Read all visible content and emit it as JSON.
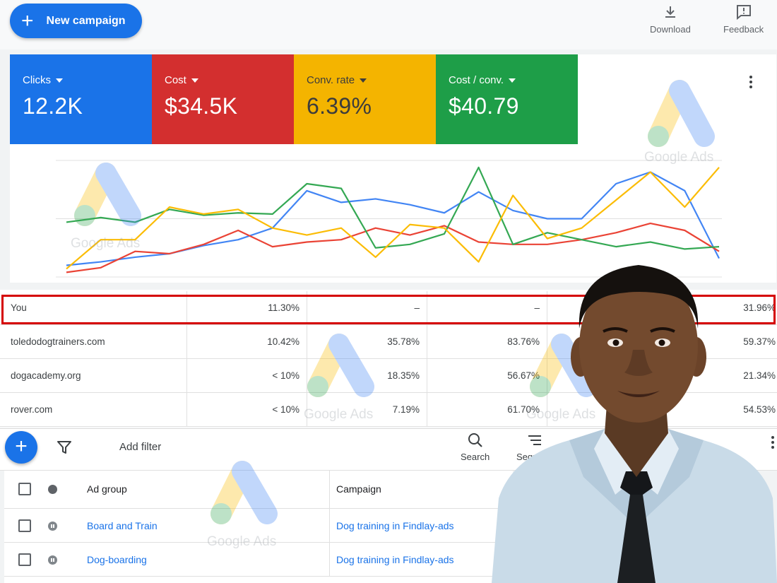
{
  "toolbar_top": {
    "new_campaign_label": "New campaign",
    "download_label": "Download",
    "feedback_label": "Feedback"
  },
  "scorecards": [
    {
      "label": "Clicks",
      "value": "12.2K",
      "color": "#1a73e8"
    },
    {
      "label": "Cost",
      "value": "$34.5K",
      "color": "#d32f2f"
    },
    {
      "label": "Conv. rate",
      "value": "6.39%",
      "color": "#f4b400"
    },
    {
      "label": "Cost / conv.",
      "value": "$40.79",
      "color": "#1e9e48"
    }
  ],
  "watermark_text": "Google Ads",
  "chart_data": {
    "type": "line",
    "x": [
      0,
      1,
      2,
      3,
      4,
      5,
      6,
      7,
      8,
      9,
      10,
      11,
      12,
      13,
      14,
      15,
      16,
      17,
      18,
      19
    ],
    "ylim": [
      0,
      100
    ],
    "grid": true,
    "series": [
      {
        "color": "#4285f4",
        "values": [
          10,
          13,
          17,
          20,
          27,
          32,
          42,
          74,
          64,
          67,
          62,
          55,
          73,
          57,
          50,
          50,
          80,
          90,
          74,
          16
        ]
      },
      {
        "color": "#ea4335",
        "values": [
          4,
          8,
          22,
          20,
          28,
          40,
          26,
          30,
          32,
          42,
          36,
          44,
          30,
          28,
          28,
          32,
          38,
          46,
          40,
          22
        ]
      },
      {
        "color": "#34a853",
        "values": [
          47,
          51,
          47,
          58,
          53,
          55,
          54,
          80,
          76,
          25,
          28,
          37,
          94,
          28,
          38,
          32,
          26,
          30,
          24,
          26
        ]
      },
      {
        "color": "#fbbc04",
        "values": [
          7,
          32,
          32,
          60,
          54,
          58,
          42,
          36,
          42,
          17,
          45,
          42,
          13,
          70,
          33,
          42,
          66,
          90,
          60,
          94
        ]
      }
    ]
  },
  "competitor_rows": [
    {
      "domain": "You",
      "c1": "11.30%",
      "c2": "–",
      "c3": "–",
      "c4": "31.96%"
    },
    {
      "domain": "toledodogtrainers.com",
      "c1": "10.42%",
      "c2": "35.78%",
      "c3": "83.76%",
      "c4": "59.37%"
    },
    {
      "domain": "dogacademy.org",
      "c1": "< 10%",
      "c2": "18.35%",
      "c3": "56.67%",
      "c4": "21.34%"
    },
    {
      "domain": "rover.com",
      "c1": "< 10%",
      "c2": "7.19%",
      "c3": "61.70%",
      "c4": "54.53%"
    }
  ],
  "tools": {
    "add_filter": "Add filter",
    "search": "Search",
    "segment": "Segment"
  },
  "adgroup_table": {
    "col_adgroup": "Ad group",
    "col_campaign": "Campaign",
    "rows": [
      {
        "ad_group": "Board and Train",
        "campaign": "Dog training in Findlay-ads"
      },
      {
        "ad_group": "Dog-boarding",
        "campaign": "Dog training in Findlay-ads"
      }
    ]
  }
}
